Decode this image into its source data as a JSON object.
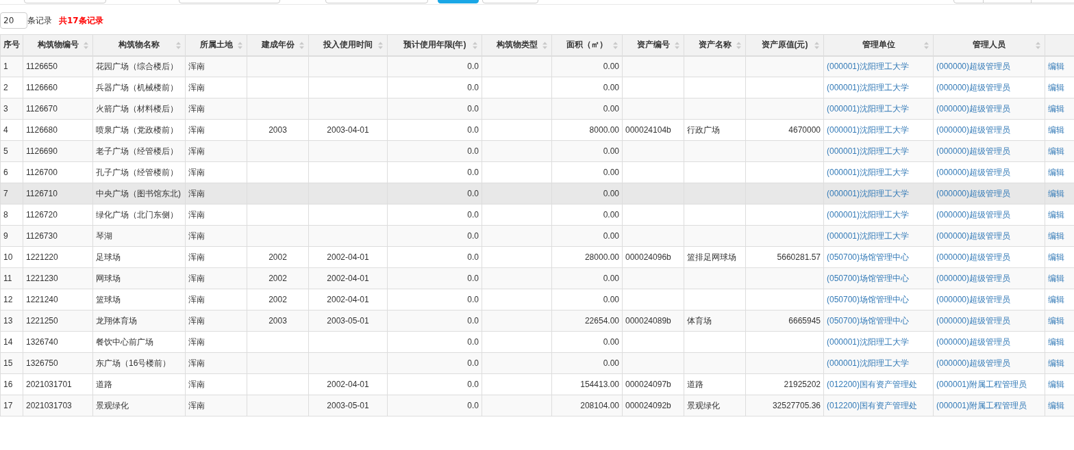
{
  "page_size": {
    "value": "20",
    "suffix": "条记录",
    "total": "共17条记录"
  },
  "columns": [
    {
      "label": "序号",
      "sortable": false
    },
    {
      "label": "构筑物编号",
      "sortable": true
    },
    {
      "label": "构筑物名称",
      "sortable": true
    },
    {
      "label": "所属土地",
      "sortable": true
    },
    {
      "label": "建成年份",
      "sortable": true
    },
    {
      "label": "投入使用时间",
      "sortable": true
    },
    {
      "label": "预计使用年限(年)",
      "sortable": true
    },
    {
      "label": "构筑物类型",
      "sortable": true
    },
    {
      "label": "面积（㎡）",
      "sortable": true
    },
    {
      "label": "资产编号",
      "sortable": true
    },
    {
      "label": "资产名称",
      "sortable": true
    },
    {
      "label": "资产原值(元)",
      "sortable": true
    },
    {
      "label": "管理单位",
      "sortable": true
    },
    {
      "label": "管理人员",
      "sortable": true
    },
    {
      "sortable": false
    }
  ],
  "rows": [
    {
      "selected": false,
      "no": "1",
      "code": "1126650",
      "name": "花园广场（综合楼后）",
      "land": "浑南",
      "life": "0.0",
      "area": "0.00",
      "unit": "(000001)沈阳理工大学",
      "manager": "(000000)超级管理员",
      "action": "编辑"
    },
    {
      "selected": false,
      "no": "2",
      "code": "1126660",
      "name": "兵器广场（机械楼前）",
      "land": "浑南",
      "life": "0.0",
      "area": "0.00",
      "unit": "(000001)沈阳理工大学",
      "manager": "(000000)超级管理员",
      "action": "编辑"
    },
    {
      "selected": false,
      "no": "3",
      "code": "1126670",
      "name": "火箭广场（材料楼后）",
      "land": "浑南",
      "life": "0.0",
      "area": "0.00",
      "unit": "(000001)沈阳理工大学",
      "manager": "(000000)超级管理员",
      "action": "编辑"
    },
    {
      "selected": false,
      "no": "4",
      "code": "1126680",
      "name": "喷泉广场（党政楼前）",
      "land": "浑南",
      "year": "2003",
      "start": "2003-04-01",
      "life": "0.0",
      "area": "8000.00",
      "asset_no": "000024104b",
      "asset_name": "行政广场",
      "value": "4670000",
      "unit": "(000001)沈阳理工大学",
      "manager": "(000000)超级管理员",
      "action": "编辑"
    },
    {
      "selected": false,
      "no": "5",
      "code": "1126690",
      "name": "老子广场（经管楼后）",
      "land": "浑南",
      "life": "0.0",
      "area": "0.00",
      "unit": "(000001)沈阳理工大学",
      "manager": "(000000)超级管理员",
      "action": "编辑"
    },
    {
      "selected": false,
      "no": "6",
      "code": "1126700",
      "name": "孔子广场（经管楼前）",
      "land": "浑南",
      "life": "0.0",
      "area": "0.00",
      "unit": "(000001)沈阳理工大学",
      "manager": "(000000)超级管理员",
      "action": "编辑"
    },
    {
      "selected": true,
      "no": "7",
      "code": "1126710",
      "name": "中央广场（图书馆东北)",
      "land": "浑南",
      "life": "0.0",
      "area": "0.00",
      "unit": "(000001)沈阳理工大学",
      "manager": "(000000)超级管理员",
      "action": "编辑"
    },
    {
      "selected": false,
      "no": "8",
      "code": "1126720",
      "name": "绿化广场（北门东侧）",
      "land": "浑南",
      "life": "0.0",
      "area": "0.00",
      "unit": "(000001)沈阳理工大学",
      "manager": "(000000)超级管理员",
      "action": "编辑"
    },
    {
      "selected": false,
      "no": "9",
      "code": "1126730",
      "name": "琴湖",
      "land": "浑南",
      "life": "0.0",
      "area": "0.00",
      "unit": "(000001)沈阳理工大学",
      "manager": "(000000)超级管理员",
      "action": "编辑"
    },
    {
      "selected": false,
      "no": "10",
      "code": "1221220",
      "name": "足球场",
      "land": "浑南",
      "year": "2002",
      "start": "2002-04-01",
      "life": "0.0",
      "area": "28000.00",
      "asset_no": "000024096b",
      "asset_name": "篮排足网球场",
      "value": "5660281.57",
      "unit": "(050700)场馆管理中心",
      "manager": "(000000)超级管理员",
      "action": "编辑"
    },
    {
      "selected": false,
      "no": "11",
      "code": "1221230",
      "name": "网球场",
      "land": "浑南",
      "year": "2002",
      "start": "2002-04-01",
      "life": "0.0",
      "area": "0.00",
      "unit": "(050700)场馆管理中心",
      "manager": "(000000)超级管理员",
      "action": "编辑"
    },
    {
      "selected": false,
      "no": "12",
      "code": "1221240",
      "name": "篮球场",
      "land": "浑南",
      "year": "2002",
      "start": "2002-04-01",
      "life": "0.0",
      "area": "0.00",
      "unit": "(050700)场馆管理中心",
      "manager": "(000000)超级管理员",
      "action": "编辑"
    },
    {
      "selected": false,
      "no": "13",
      "code": "1221250",
      "name": "龙翔体育场",
      "land": "浑南",
      "year": "2003",
      "start": "2003-05-01",
      "life": "0.0",
      "area": "22654.00",
      "asset_no": "000024089b",
      "asset_name": "体育场",
      "value": "6665945",
      "unit": "(050700)场馆管理中心",
      "manager": "(000000)超级管理员",
      "action": "编辑"
    },
    {
      "selected": false,
      "no": "14",
      "code": "1326740",
      "name": "餐饮中心前广场",
      "land": "浑南",
      "life": "0.0",
      "area": "0.00",
      "unit": "(000001)沈阳理工大学",
      "manager": "(000000)超级管理员",
      "action": "编辑"
    },
    {
      "selected": false,
      "no": "15",
      "code": "1326750",
      "name": "东广场（16号楼前）",
      "land": "浑南",
      "life": "0.0",
      "area": "0.00",
      "unit": "(000001)沈阳理工大学",
      "manager": "(000000)超级管理员",
      "action": "编辑"
    },
    {
      "selected": false,
      "no": "16",
      "code": "2021031701",
      "name": "道路",
      "land": "浑南",
      "start": "2002-04-01",
      "life": "0.0",
      "area": "154413.00",
      "asset_no": "000024097b",
      "asset_name": "道路",
      "value": "21925202",
      "unit": "(012200)国有资产管理处",
      "manager": "(000001)附属工程管理员",
      "action": "编辑"
    },
    {
      "selected": false,
      "no": "17",
      "code": "2021031703",
      "name": "景观绿化",
      "land": "浑南",
      "start": "2003-05-01",
      "life": "0.0",
      "area": "208104.00",
      "asset_no": "000024092b",
      "asset_name": "景观绿化",
      "value": "32527705.36",
      "unit": "(012200)国有资产管理处",
      "manager": "(000001)附属工程管理员",
      "action": "编辑"
    }
  ]
}
